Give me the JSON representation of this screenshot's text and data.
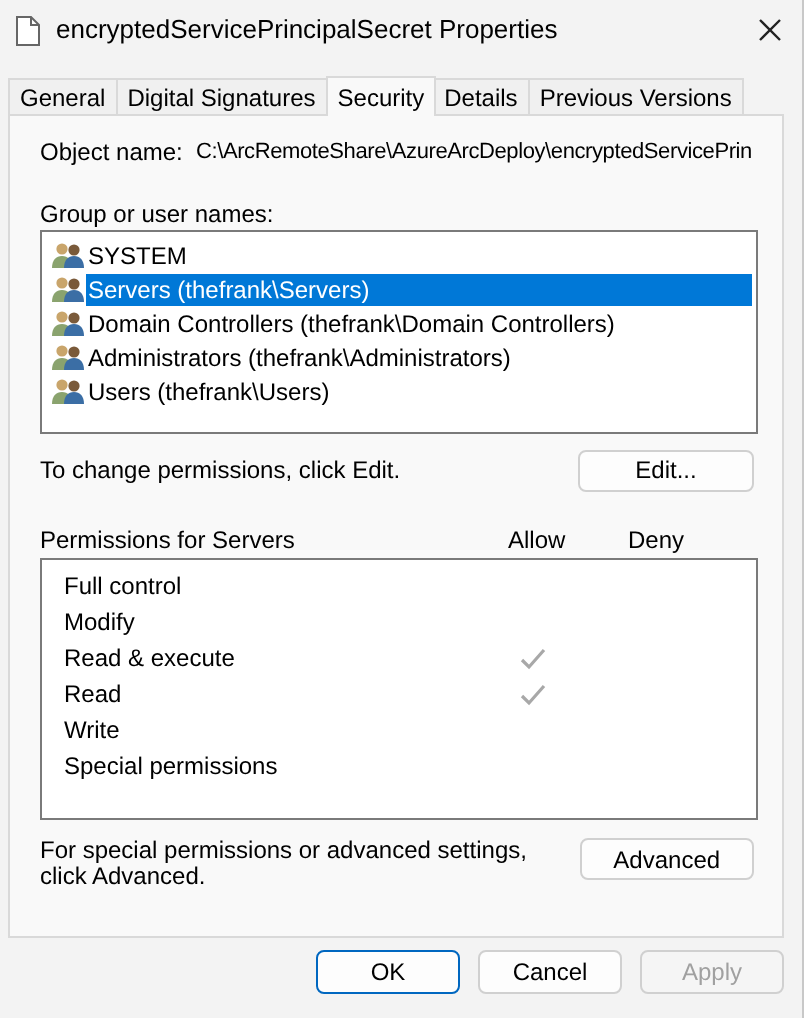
{
  "window": {
    "title": "encryptedServicePrincipalSecret Properties"
  },
  "tabs": [
    {
      "label": "General",
      "selected": false
    },
    {
      "label": "Digital Signatures",
      "selected": false
    },
    {
      "label": "Security",
      "selected": true
    },
    {
      "label": "Details",
      "selected": false
    },
    {
      "label": "Previous Versions",
      "selected": false
    }
  ],
  "object_name": {
    "label": "Object name:",
    "value": "C:\\ArcRemoteShare\\AzureArcDeploy\\encryptedServicePrin"
  },
  "groups": {
    "label": "Group or user names:",
    "items": [
      {
        "name": "SYSTEM",
        "selected": false
      },
      {
        "name": "Servers (thefrank\\Servers)",
        "selected": true
      },
      {
        "name": "Domain Controllers (thefrank\\Domain Controllers)",
        "selected": false
      },
      {
        "name": "Administrators (thefrank\\Administrators)",
        "selected": false
      },
      {
        "name": "Users (thefrank\\Users)",
        "selected": false
      }
    ]
  },
  "change_hint": "To change permissions, click Edit.",
  "edit_button": "Edit...",
  "permissions": {
    "label": "Permissions for Servers",
    "columns": [
      "Allow",
      "Deny"
    ],
    "rows": [
      {
        "name": "Full control",
        "allow": false,
        "deny": false
      },
      {
        "name": "Modify",
        "allow": false,
        "deny": false
      },
      {
        "name": "Read & execute",
        "allow": true,
        "deny": false
      },
      {
        "name": "Read",
        "allow": true,
        "deny": false
      },
      {
        "name": "Write",
        "allow": false,
        "deny": false
      },
      {
        "name": "Special permissions",
        "allow": false,
        "deny": false
      }
    ]
  },
  "advanced_hint": "For special permissions or advanced settings, click Advanced.",
  "advanced_button": "Advanced",
  "buttons": [
    {
      "label": "OK",
      "kind": "default",
      "disabled": false
    },
    {
      "label": "Cancel",
      "kind": "normal",
      "disabled": false
    },
    {
      "label": "Apply",
      "kind": "normal",
      "disabled": true
    }
  ]
}
